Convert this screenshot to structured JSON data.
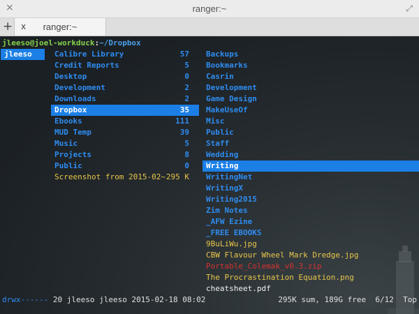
{
  "window": {
    "title": "ranger:~",
    "new_tab": "+",
    "close_icon": "×",
    "maximize_icon": "⤢"
  },
  "tab": {
    "label": "ranger:~",
    "close": "x"
  },
  "prompt": {
    "userhost": "jleeso@joel-workduck",
    "sep": ":",
    "path": "~/Dropbox"
  },
  "col1": [
    "jleeso"
  ],
  "col2": [
    {
      "name": "Calibre Library",
      "count": "57"
    },
    {
      "name": "Credit Reports",
      "count": "5"
    },
    {
      "name": "Desktop",
      "count": "0"
    },
    {
      "name": "Development",
      "count": "2"
    },
    {
      "name": "Downloads",
      "count": "2"
    },
    {
      "name": "Dropbox",
      "count": "35",
      "selected": true
    },
    {
      "name": "Ebooks",
      "count": "111"
    },
    {
      "name": "MUD Temp",
      "count": "39"
    },
    {
      "name": "Music",
      "count": "5"
    },
    {
      "name": "Projects",
      "count": "8"
    },
    {
      "name": "Public",
      "count": "0"
    },
    {
      "name": "Screenshot from 2015-02~",
      "count": "295 K",
      "file": true
    }
  ],
  "col3": [
    {
      "name": "Backups"
    },
    {
      "name": "Bookmarks"
    },
    {
      "name": "Casrin"
    },
    {
      "name": "Development"
    },
    {
      "name": "Game Design"
    },
    {
      "name": "MakeUseOf"
    },
    {
      "name": "Misc"
    },
    {
      "name": "Public"
    },
    {
      "name": "Staff"
    },
    {
      "name": "Wedding"
    },
    {
      "name": "Writing",
      "selected": true
    },
    {
      "name": "WritingNet"
    },
    {
      "name": "WritingX"
    },
    {
      "name": "Writing2015"
    },
    {
      "name": "Zim Notes"
    },
    {
      "name": "_AFW Ezine"
    },
    {
      "name": "_FREE EBOOKS"
    },
    {
      "name": "9BuLiWu.jpg",
      "kind": "file"
    },
    {
      "name": "CBW Flavour Wheel Mark Dredge.jpg",
      "kind": "file"
    },
    {
      "name": "Portable_Colemak_v0.3.zip",
      "kind": "red"
    },
    {
      "name": "The Procrastination Equation.png",
      "kind": "file"
    },
    {
      "name": "cheatsheet.pdf",
      "kind": "plain"
    }
  ],
  "status": {
    "perm": "drwx------",
    "info": " 20 jleeso jleeso 2015-02-18 08:02",
    "right": "295K sum, 189G free  6/12  Top"
  }
}
